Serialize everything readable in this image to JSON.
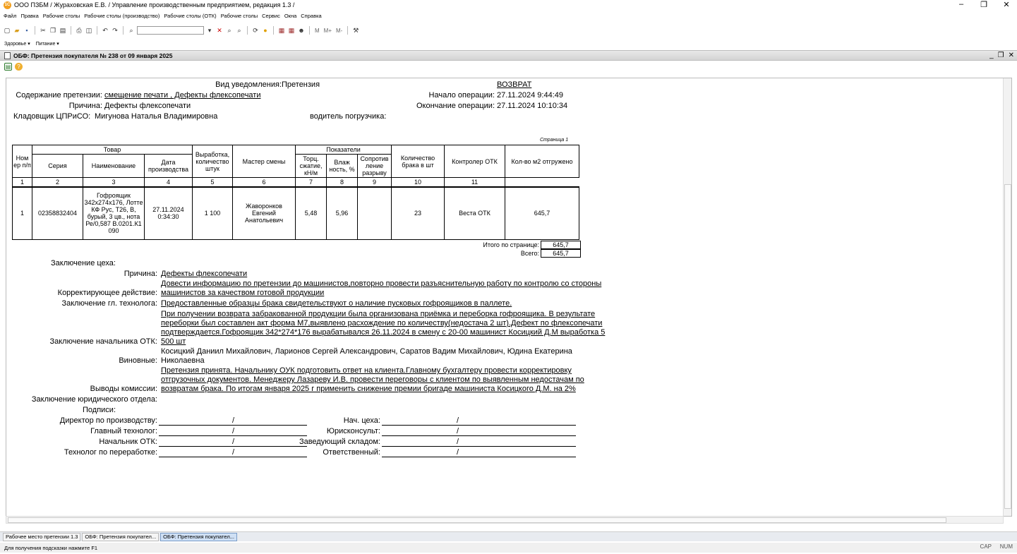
{
  "window": {
    "title": "ООО ПЗБМ / Жураховская Е.В. / Управление производственным предприятием, редакция 1.3 /",
    "minimize": "–",
    "restore": "❐",
    "close": "✕"
  },
  "menu": [
    "Файл",
    "Правка",
    "Рабочие столы",
    "Рабочие столы (производство)",
    "Рабочие столы (ОТК)",
    "Рабочие столы",
    "Сервис",
    "Окна",
    "Справка"
  ],
  "toolbar": {
    "mbuttons": [
      "M",
      "M+",
      "M-"
    ]
  },
  "subbar": [
    "Здоровье ▾",
    "Питание ▾"
  ],
  "document": {
    "title": "ОБФ: Претензия покупателя № 238 от 09 января 2025",
    "ctl_min": "_",
    "ctl_restore": "❐",
    "ctl_close": "✕"
  },
  "report": {
    "notice_type_label": "Вид уведомления:",
    "notice_type_value": "Претензия",
    "return_label": "ВОЗВРАТ",
    "claim_content_label": "Содержание претензии:",
    "claim_content_value": "смещение печати , Дефекты флексопечати",
    "reason_label": "Причина:",
    "reason_value": "Дефекты флексопечати",
    "storekeeper_label": "Кладовщик ЦПРиСО:",
    "storekeeper_value": "Мигунова Наталья Владимировна",
    "driver_label": "водитель погрузчика:",
    "op_start_label": "Начало операции:",
    "op_start_value": "27.11.2024 9:44:49",
    "op_end_label": "Окончание операции:",
    "op_end_value": "27.11.2024 10:10:34",
    "page_label": "Страница 1",
    "table": {
      "h_num": "Ном ер п/п",
      "h_goods": "Товар",
      "h_series": "Серия",
      "h_name": "Наименование",
      "h_date": "Дата производства",
      "h_output": "Выработка, количество штук",
      "h_master": "Мастер смены",
      "h_indicators": "Показатели",
      "h_torc": "Торц. сжатие, кН/м",
      "h_moist": "Влаж ность, %",
      "h_resist": "Сопротив ление разрыву",
      "h_defect": "Количество брака в шт",
      "h_controller": "Контролер ОТК",
      "h_shipped": "Кол-во м2 отгружено",
      "col_numbers": [
        "1",
        "2",
        "3",
        "4",
        "5",
        "6",
        "7",
        "8",
        "9",
        "10",
        "11"
      ],
      "row": {
        "num": "1",
        "series": "02358832404",
        "name": "Гофроящик 342х274х176, Лотте КФ Рус, Т26, В, бурый, 3 цв., нота Ре/0,587 В.0201.К1 090",
        "date": "27.11.2024 0:34:30",
        "output": "1 100",
        "master": "Жаворонков Евгений Анатольевич",
        "torc": "5,48",
        "moist": "5,96",
        "resist": "",
        "defect": "23",
        "controller": "Веста ОТК",
        "shipped": "645,7"
      }
    },
    "page_total_label": "Итого по странице:",
    "page_total_value": "645,7",
    "total_label": "Всего:",
    "total_value": "645,7",
    "workshop_conclusion_label": "Заключение цеха:",
    "w_reason_label": "Причина:",
    "w_reason_value": "Дефекты флексопечати",
    "corrective_label": "Корректирующее действие:",
    "corrective_value": "Довести информацию по претензии до машинистов,повторно   провести разъяснительную работу по контролю со стороны машинистов за  качеством готовой продукции",
    "technologist_label": "Заключение гл. технолога:",
    "technologist_value": " Предоставленные образцы брака   свидетельствуют о наличие пусковых гофроящиков в паллете.",
    "otk_head_label": "Заключение начальника ОТК:",
    "otk_head_value": "При получении возврата забракованной продукции была организована приёмка и переборка гофроящика. В результате переборки был составлен  акт форма М7,выявлено расхождение по количеству(недостача 2 шт).Дефект по флексопечати подтверждается.Гофроящик 342*274*176 вырабатывался 26.11.2024 в смену с 20-00 машинист Косицкий Д.М выработка 5 500 шт",
    "guilty_label": "Виновные:",
    "guilty_value": "Косицкий Даниил Михайлович, Ларионов Сергей Александрович, Саратов Вадим Михайлович, Юдина Екатерина Николаевна",
    "commission_label": "Выводы комиссии:",
    "commission_value": "Претензия принята. Начальнику ОУК подготовить ответ на клиента.Главному бухгалтеру провести корректировку отгрузочных документов. Менеджеру Лазареву И.В. провести переговоры с клиентом по  выявленным недостачам по возвратам брака. По итогам января 2025 г применить снижение премии  бригаде машиниста Косицкого Д.М. на 2%",
    "legal_label": "Заключение юридического отдела:",
    "signatures_label": "Подписи:",
    "sign_slash": "/",
    "sign_left": [
      "Директор по производству:",
      "Главный технолог:",
      "Начальник ОТК:",
      "Технолог по переработке:"
    ],
    "sign_right": [
      "Нач. цеха:",
      "Юрисконсульт:",
      "Заведующий складом:",
      "Ответственный:"
    ]
  },
  "taskbar": [
    "Рабочее место претензии 1.3",
    "ОБФ: Претензия покупател...",
    "ОБФ: Претензия покупател..."
  ],
  "status": {
    "hint": "Для получения подсказки нажмите F1",
    "cap": "CAP",
    "num": "NUM"
  }
}
